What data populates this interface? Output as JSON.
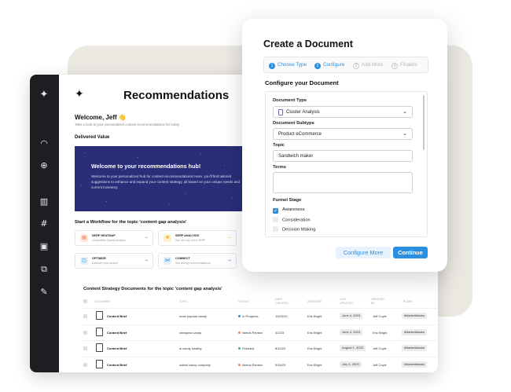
{
  "app": {
    "title": "Recommendations",
    "welcome": "Welcome, Jeff 👋",
    "welcome_sub": "Take a look at your personalized content recommendations for today.",
    "delivered_value": "Delivered Value",
    "hero": {
      "title": "Welcome to your recommendations hub!",
      "text": "Welcome to your personalized hub for content recommendations! Here, you'll find tailored suggestions to enhance and expand your content strategy, all based on your unique needs and current inventory."
    },
    "workflow_title": "Start a Workflow for the topic 'content gap analysis'",
    "workflows": [
      {
        "title": "SERP HEATMAP",
        "subtitle": "Competitive Quality Analysis",
        "icon": "heatmap-icon",
        "color": "#f08a5d"
      },
      {
        "title": "SERP ANALYSIS",
        "subtitle": "See all x-ray of the SERP",
        "icon": "bulb-icon",
        "color": "#f5b82e"
      },
      {
        "title": "OPTIMIZE",
        "subtitle": "Optimize your content",
        "icon": "optimize-icon",
        "color": "#2a8fe0"
      },
      {
        "title": "CONNECT",
        "subtitle": "See linking recommendations",
        "icon": "connect-icon",
        "color": "#2a8fe0"
      }
    ],
    "table_title": "Content Strategy Documents for the topic 'content gap analysis'",
    "columns": [
      "DOCUMENT",
      "TOPIC",
      "STATUS",
      "DATE CREATED",
      "ASSIGNEE",
      "LAST UPDATED",
      "UPDATED BY",
      "PLANS"
    ],
    "rows": [
      {
        "document": "Content Brief",
        "topic": "most popular candy",
        "status": "In Progress",
        "status_color": "#2a8fe0",
        "created": "10/23/22",
        "assignee": "Eric Bright",
        "updated": "June 4, 2023",
        "updated_by": "Jeff Coyle",
        "plan": "#MarketAttacks"
      },
      {
        "document": "Content Brief",
        "topic": "cheapest candy",
        "status": "Needs Review",
        "status_color": "#f08a5d",
        "created": "4/2/23",
        "assignee": "Eric Bright",
        "updated": "June 4, 2023",
        "updated_by": "Eric Bright",
        "plan": "#MarketAttacks"
      },
      {
        "document": "Content Brief",
        "topic": "is candy healthy",
        "status": "Finished",
        "status_color": "#3bb273",
        "created": "8/10/22",
        "assignee": "Eric Bright",
        "updated": "August 1, 2023",
        "updated_by": "Jeff Coyle",
        "plan": "#MarketAttacks"
      },
      {
        "document": "Content Brief",
        "topic": "oldest candy company",
        "status": "Needs Review",
        "status_color": "#f08a5d",
        "created": "5/15/23",
        "assignee": "Eric Bright",
        "updated": "July 4, 2023",
        "updated_by": "Jeff Coyle",
        "plan": "#MarketAttacks"
      }
    ],
    "rail_icons": [
      "sparkle-icon",
      "gauge-icon",
      "zoom-icon",
      "columns-icon",
      "hash-icon",
      "document-icon",
      "copy-icon",
      "edit-icon"
    ]
  },
  "modal": {
    "title": "Create a Document",
    "steps": [
      {
        "num": "1",
        "label": "Choose Type",
        "active": true
      },
      {
        "num": "2",
        "label": "Configure",
        "active": true
      },
      {
        "num": "3",
        "label": "Add More",
        "active": false
      },
      {
        "num": "4",
        "label": "Finalize",
        "active": false
      }
    ],
    "section_title": "Configure your Document",
    "document_type_label": "Document Type",
    "document_type_value": "Cluster Analysis",
    "document_subtype_label": "Document Subtype",
    "document_subtype_value": "Product eCommerce",
    "topic_label": "Topic",
    "topic_value": "Sandwich maker",
    "terms_label": "Terms",
    "terms_value": "",
    "funnel_label": "Funnel Stage",
    "funnel_options": [
      {
        "label": "Awareness",
        "checked": true
      },
      {
        "label": "Consideration",
        "checked": false
      },
      {
        "label": "Decision Making",
        "checked": false
      }
    ],
    "configure_more": "Configure More",
    "continue": "Continue"
  },
  "colors": {
    "accent": "#2a8fe0",
    "rail": "#1d1e22",
    "hero": "#2a2e78",
    "backdrop": "#ece9e3"
  }
}
